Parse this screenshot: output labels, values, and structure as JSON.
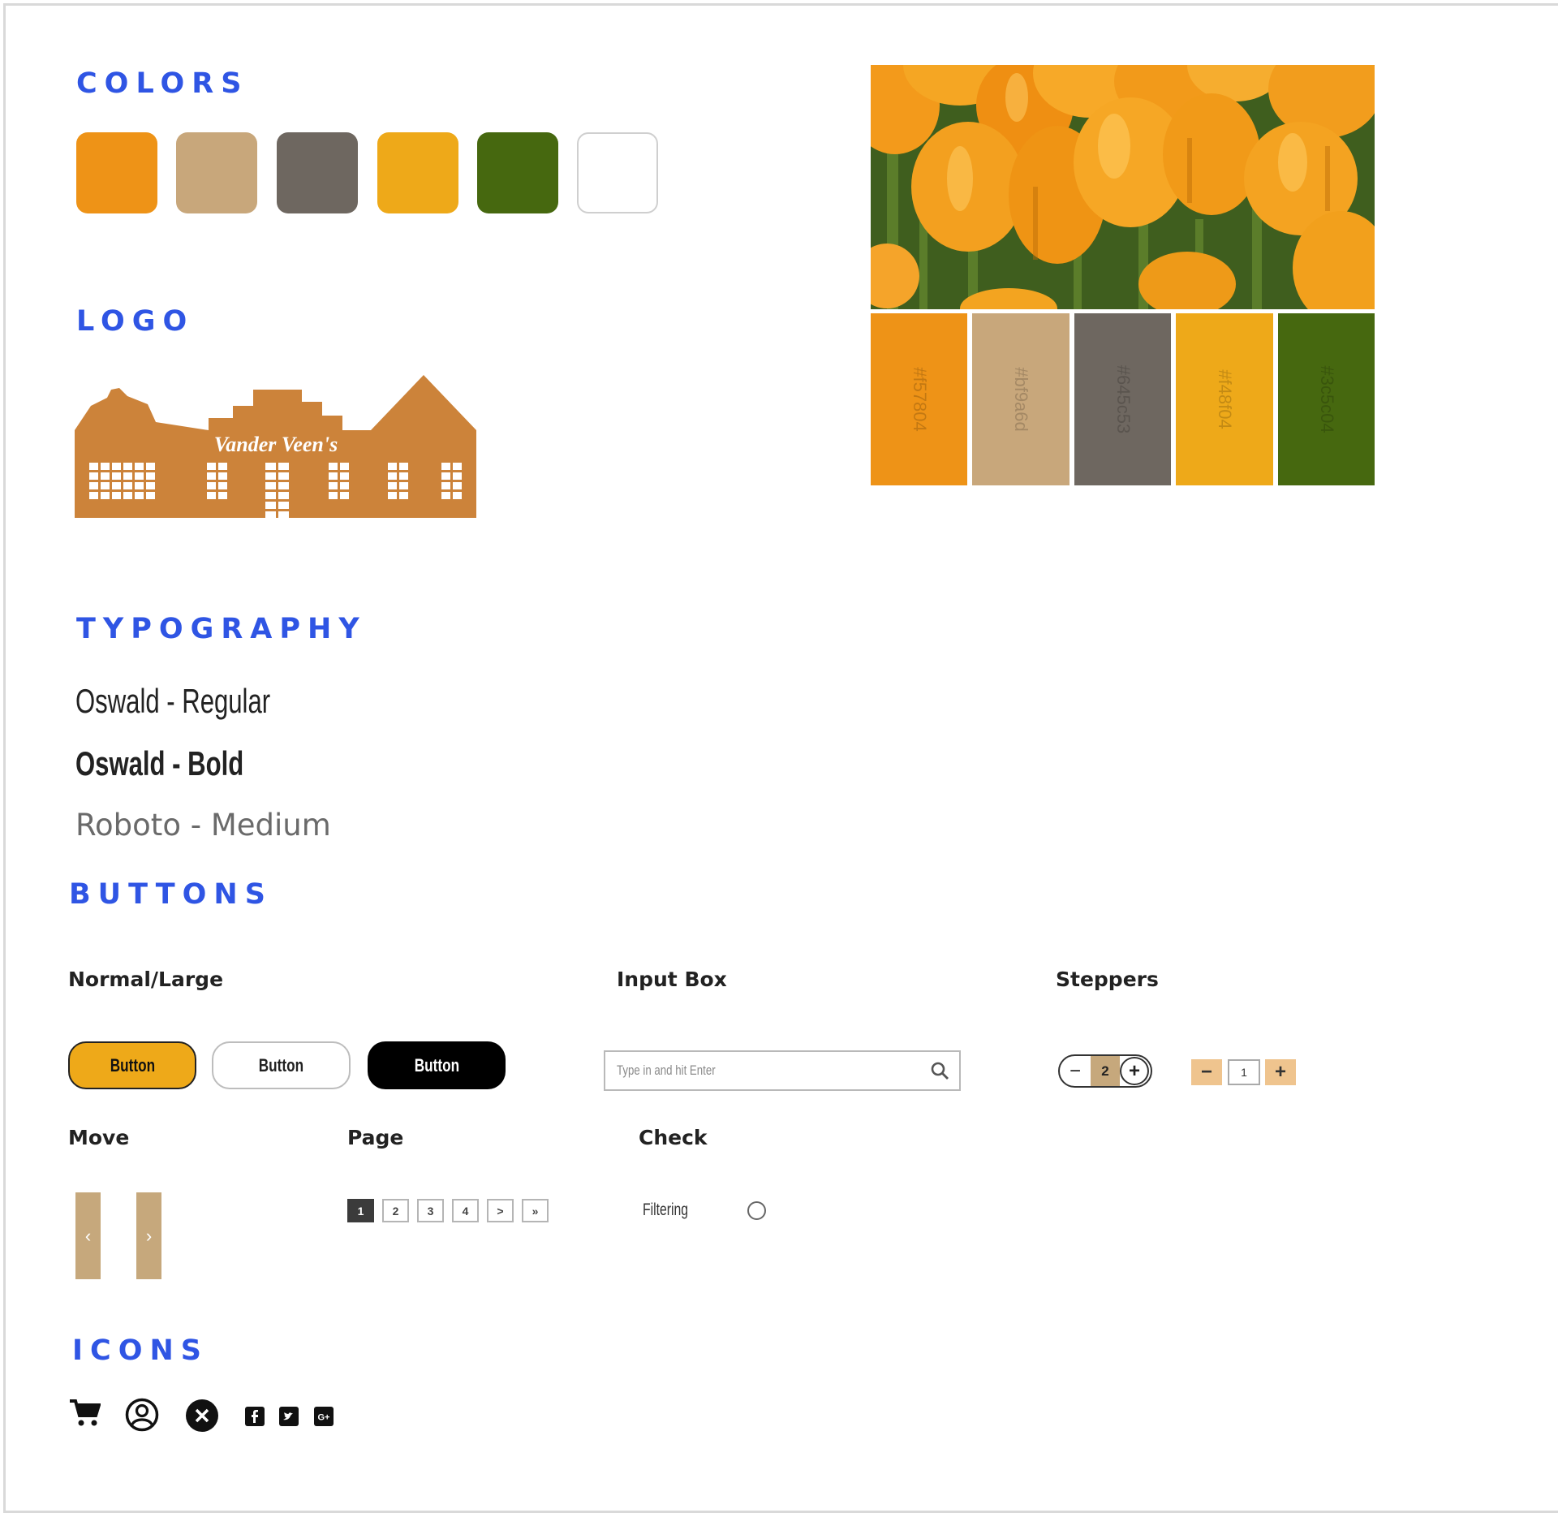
{
  "headings": {
    "colors": "COLORS",
    "logo": "LOGO",
    "typography": "TYPOGRAPHY",
    "buttons": "BUTTONS",
    "icons": "ICONS"
  },
  "colors": {
    "swatches": [
      "#ee9317",
      "#c8a77b",
      "#6e6760",
      "#eea919",
      "#46680f",
      "#ffffff"
    ],
    "palette": [
      {
        "hex": "#f57804",
        "color": "#ee9317"
      },
      {
        "hex": "#bf9a6d",
        "color": "#c8a77b"
      },
      {
        "hex": "#645c53",
        "color": "#6e6760"
      },
      {
        "hex": "#f48f04",
        "color": "#eea919"
      },
      {
        "hex": "#3c5c04",
        "color": "#46680f"
      }
    ],
    "accent": "#2f55e4"
  },
  "logo": {
    "text": "Vander Veen's",
    "color": "#cc833a"
  },
  "typography": {
    "regular": "Oswald - Regular",
    "bold": "Oswald - Bold",
    "medium": "Roboto - Medium"
  },
  "buttons": {
    "normal_large_label": "Normal/Large",
    "button_text": "Button",
    "input_box_label": "Input Box",
    "input_placeholder": "Type in and hit Enter",
    "steppers_label": "Steppers",
    "stepper_round_value": "2",
    "stepper_square_value": "1",
    "minus": "−",
    "plus": "+",
    "move_label": "Move",
    "move_prev": "‹",
    "move_next": "›",
    "page_label": "Page",
    "pages": [
      "1",
      "2",
      "3",
      "4",
      ">",
      "»"
    ],
    "check_label": "Check",
    "filtering_label": "Filtering"
  },
  "icons": [
    "cart-icon",
    "user-circle-icon",
    "close-circle-icon",
    "facebook-icon",
    "twitter-icon",
    "google-plus-icon"
  ]
}
